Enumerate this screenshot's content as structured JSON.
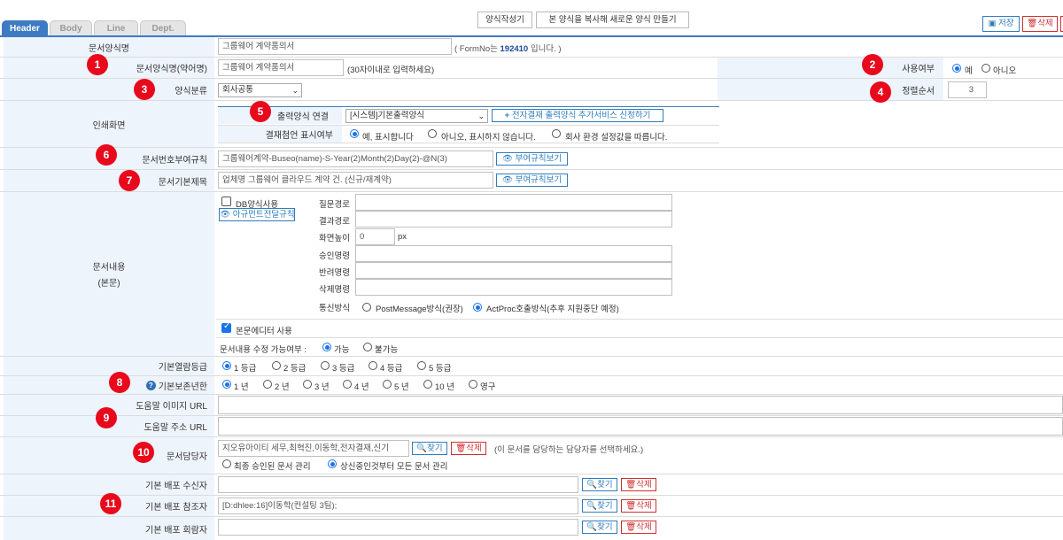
{
  "tabs": [
    "Header",
    "Body",
    "Line",
    "Dept."
  ],
  "toolbar": {
    "form_write": "양식작성기",
    "copy_form": "본 양식을 복사해 새로운 양식 만들기",
    "save": "저장",
    "delete": "삭제"
  },
  "badges": [
    "1",
    "2",
    "3",
    "4",
    "5",
    "6",
    "7",
    "8",
    "9",
    "10",
    "11"
  ],
  "form_name": {
    "label": "문서양식명",
    "value": "그룹웨어 계약품의서",
    "note_pre": "( FormNo는 ",
    "note_num": "192410",
    "note_post": " 입니다. )"
  },
  "short_name": {
    "label": "문서양식명(약어명)",
    "value": "그룹웨어 계약품의서",
    "hint": "(30자이내로 입력하세요)"
  },
  "usage": {
    "label": "사용여부",
    "yes": "예",
    "no": "아니오"
  },
  "category": {
    "label": "양식분류",
    "value": "회사공통"
  },
  "sort_order": {
    "label": "정렬순서",
    "value": "3"
  },
  "print_screen": {
    "label": "인쇄화면",
    "output_label": "출력양식 연결",
    "output_value": "[시스템]기본출력양식",
    "add_service": "전자결재 출력양식 추가서비스 신청하기",
    "approval_label": "결재첨언 표시여부",
    "opt1": "예, 표시합니다",
    "opt2": "아니오, 표시하지 않습니다.",
    "opt3": "회사 환경 설정값을 따릅니다."
  },
  "doc_number": {
    "label": "문서번호부여규칙",
    "value": "그룹웨어계약-Buseo(name)-S-Year(2)Month(2)Day(2)-@N(3)",
    "button": "부여규칙보기"
  },
  "doc_title": {
    "label": "문서기본제목",
    "value": "업체명 그룹웨어 클라우드 계약 건. (신규/재계약)",
    "button": "부여규칙보기"
  },
  "doc_content": {
    "label1": "문서내용",
    "label2": "(본문)",
    "db_use": "DB양식사용",
    "arg_button": "아규먼트전달규칙",
    "fields": [
      "질문경로",
      "결과경로",
      "화면높이",
      "승인명령",
      "반려명령",
      "삭제명령"
    ],
    "height_value": "0",
    "px": "px",
    "comm_label": "통신방식",
    "comm_opt1": "PostMessage방식(권장)",
    "comm_opt2": "ActProc호출방식(추후 지원중단 예정)",
    "editor_use": "본문에디터 사용",
    "editable_label": "문서내용 수정 가능여부 :",
    "editable_yes": "가능",
    "editable_no": "불가능"
  },
  "read_level": {
    "label": "기본열람등급",
    "options": [
      "1 등급",
      "2 등급",
      "3 등급",
      "4 등급",
      "5 등급"
    ]
  },
  "retention": {
    "label": "기본보존년한",
    "options": [
      "1 년",
      "2 년",
      "3 년",
      "4 년",
      "5 년",
      "10 년",
      "영구"
    ]
  },
  "help_image": {
    "label": "도움말 이미지 URL"
  },
  "help_url": {
    "label": "도움말 주소 URL"
  },
  "manager": {
    "label": "문서담당자",
    "value": "지오유아이티 세무,최혁진,이동학,전자결재,신기",
    "find": "찾기",
    "delete": "삭제",
    "hint": "(이 문서를 담당하는 담당자를 선택하세요.)",
    "opt1": "최종 승인된 문서 관리",
    "opt2": "상신중인것부터 모든 문서 관리"
  },
  "dist_recipient": {
    "label": "기본 배포 수신자",
    "value": "",
    "find": "찾기",
    "delete": "삭제"
  },
  "dist_ref": {
    "label": "기본 배포 참조자",
    "value": "[D:dhlee:16]이동학(컨설팅 3팀);",
    "find": "찾기",
    "delete": "삭제"
  },
  "dist_circ": {
    "label": "기본 배포 회람자",
    "value": "",
    "find": "찾기",
    "delete": "삭제"
  },
  "colors": {
    "accent": "#3e7bc2",
    "label_bg": "#eef4fb",
    "badge": "#e8091c",
    "blue_btn": "#2f7dbd",
    "red_btn": "#d03030"
  }
}
